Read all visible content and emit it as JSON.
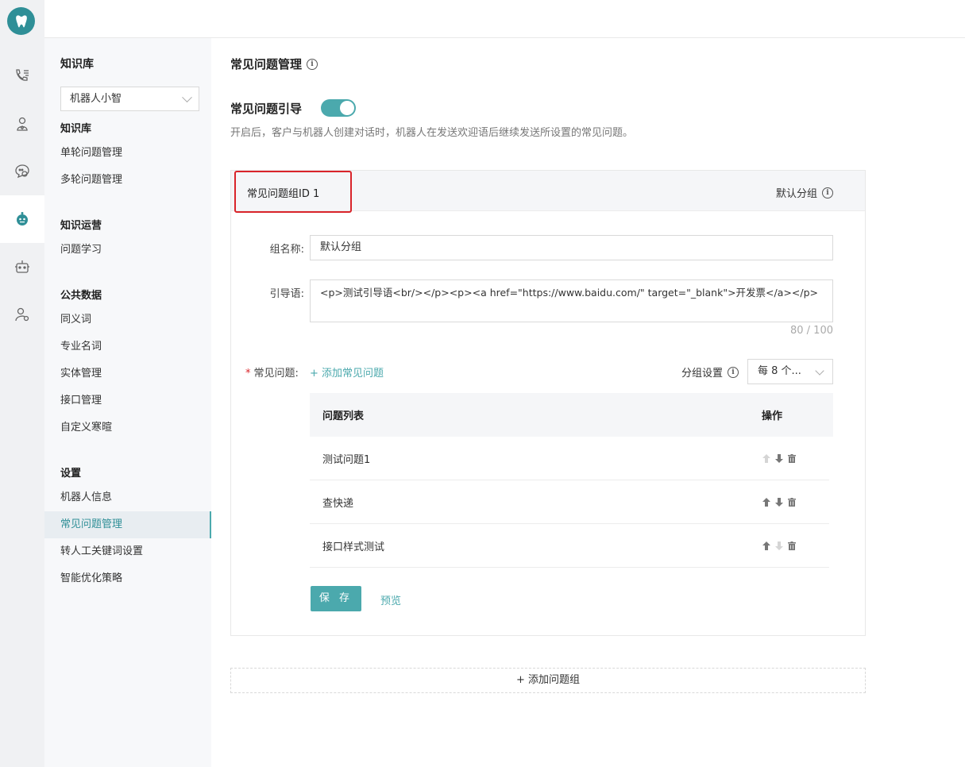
{
  "rail": {
    "items": [
      "phone-list-icon",
      "user-heart-icon",
      "chat-settings-icon",
      "robot-icon",
      "bot-icon",
      "user-settings-icon"
    ],
    "active": "robot-icon"
  },
  "subnav": {
    "title": "知识库",
    "bot_select": "机器人小智",
    "groups": [
      {
        "label": "知识库",
        "items": [
          "单轮问题管理",
          "多轮问题管理"
        ]
      },
      {
        "label": "知识运营",
        "items": [
          "问题学习"
        ]
      },
      {
        "label": "公共数据",
        "items": [
          "同义词",
          "专业名词",
          "实体管理",
          "接口管理",
          "自定义寒暄"
        ]
      },
      {
        "label": "设置",
        "items": [
          "机器人信息",
          "常见问题管理",
          "转人工关键词设置",
          "智能优化策略"
        ]
      }
    ],
    "active_item": "常见问题管理"
  },
  "main": {
    "title": "常见问题管理",
    "toggle_label": "常见问题引导",
    "toggle_on": true,
    "toggle_desc": "开启后，客户与机器人创建对话时，机器人在发送欢迎语后继续发送所设置的常见问题。",
    "group": {
      "id_label": "常见问题组ID 1",
      "default_label": "默认分组",
      "name_label": "组名称:",
      "name_value": "默认分组",
      "guide_label": "引导语:",
      "guide_value": "<p>测试引导语<br/></p><p><a href=\"https://www.baidu.com/\" target=\"_blank\">开发票</a></p>",
      "counter": "80 / 100",
      "faq_label": "常见问题:",
      "add_faq": "+ 添加常见问题",
      "group_setting": "分组设置",
      "per_group": "每 8 个...",
      "table_headers": [
        "问题列表",
        "操作"
      ],
      "rows": [
        {
          "question": "测试问题1",
          "up_enabled": false,
          "down_enabled": true
        },
        {
          "question": "查快递",
          "up_enabled": true,
          "down_enabled": true
        },
        {
          "question": "接口样式测试",
          "up_enabled": true,
          "down_enabled": false
        }
      ],
      "save": "保 存",
      "preview": "预览"
    },
    "add_group": "+ 添加问题组"
  },
  "colors": {
    "accent": "#4ba9ad",
    "highlight": "#d9242a",
    "brand": "#2f8f97"
  }
}
